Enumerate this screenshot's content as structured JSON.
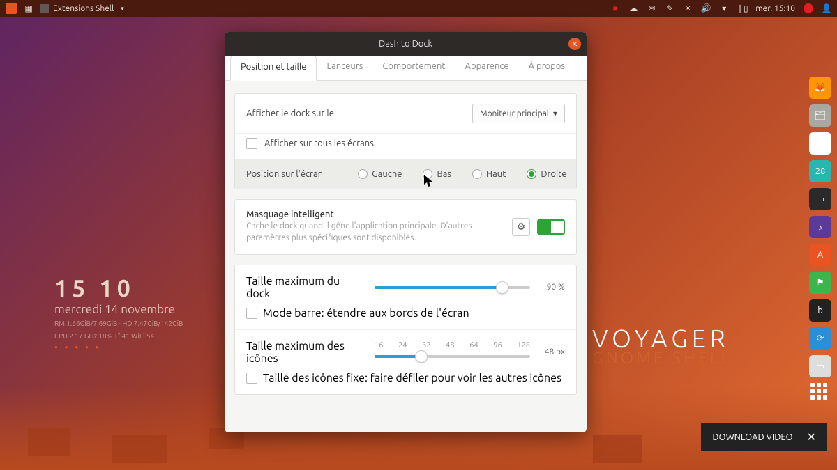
{
  "topbar": {
    "app_label": "Extensions Shell",
    "clock": "mer. 15:10"
  },
  "desktop": {
    "time": "15 10",
    "date": "mercredi 14 novembre",
    "stats1": "RM 1.66GiB/7.69GiB · HD 7.47GiB/142GiB",
    "stats2": "CPU 2.17 GHz 18% T° 41  WiFi 54",
    "voyager": "VOYAGER",
    "voyager_sub": "GNOME SHELL"
  },
  "window": {
    "title": "Dash to Dock",
    "tabs": {
      "position": "Position et taille",
      "launchers": "Lanceurs",
      "behavior": "Comportement",
      "appearance": "Apparence",
      "about": "À propos"
    },
    "monitor_label": "Afficher le dock sur le",
    "monitor_value": "Moniteur principal",
    "all_screens": "Afficher sur tous les écrans.",
    "position_label": "Position sur l'écran",
    "position_opts": {
      "left": "Gauche",
      "bottom": "Bas",
      "top": "Haut",
      "right": "Droite"
    },
    "intellihide_title": "Masquage intelligent",
    "intellihide_desc": "Cache le dock quand il gêne l'application principale. D'autres paramètres plus spécifiques sont disponibles.",
    "dock_size_label": "Taille maximum du dock",
    "dock_size_value": "90 %",
    "panel_mode": "Mode barre: étendre aux bords de l'écran",
    "icon_size_label": "Taille maximum des icônes",
    "icon_ticks": {
      "t16": "16",
      "t24": "24",
      "t32": "32",
      "t48": "48",
      "t64": "64",
      "t96": "96",
      "t128": "128"
    },
    "icon_size_value": "48 px",
    "fixed_icon": "Taille des icônes fixe: faire défiler pour voir les autres icônes"
  },
  "banner": {
    "text": "DOWNLOAD VIDEO"
  },
  "cal_day": "28"
}
